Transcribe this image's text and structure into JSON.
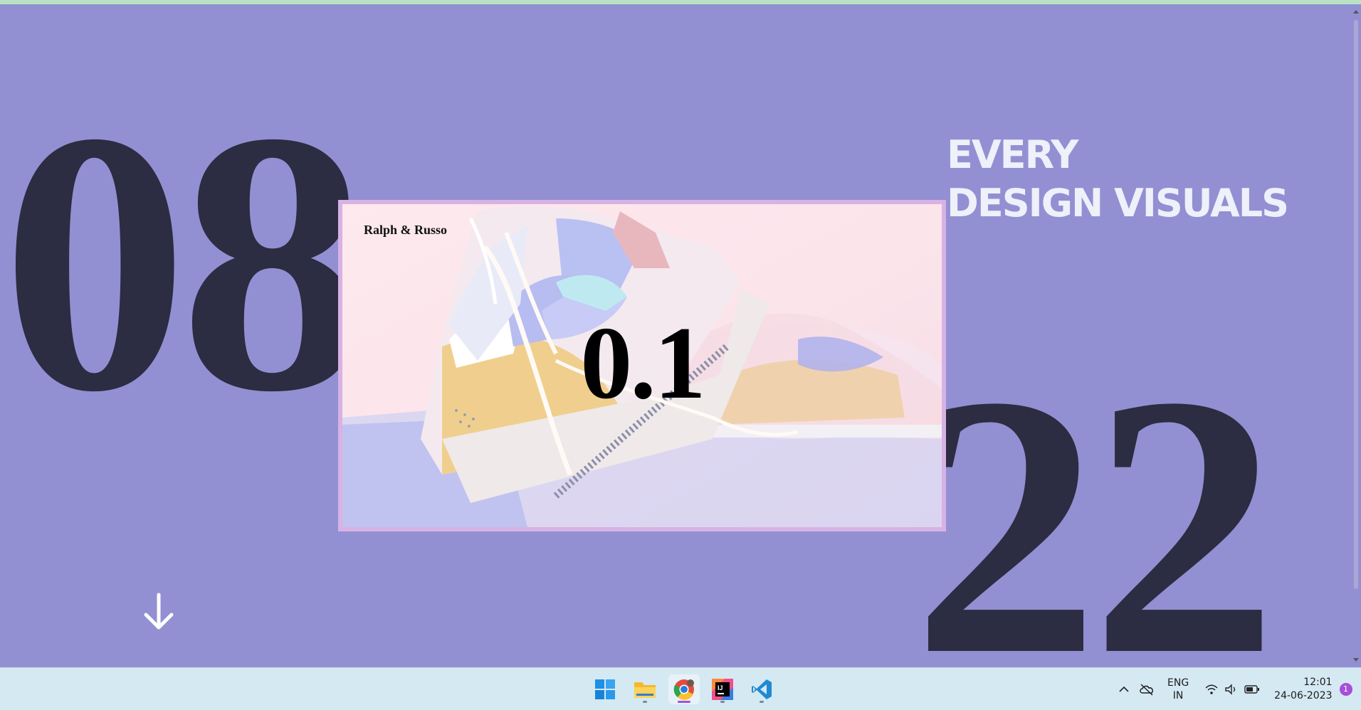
{
  "hero": {
    "number_left": "08",
    "number_right": "22",
    "headline_line1": "EVERY",
    "headline_line2": "DESIGN VISUALS"
  },
  "card": {
    "brand": "Ralph & Russo",
    "number": "0.1",
    "image_subject": "pastel sneakers photo"
  },
  "scroll_cue": {
    "icon": "arrow-down-icon"
  },
  "taskbar": {
    "apps": [
      {
        "name": "Start",
        "icon": "windows-start-icon"
      },
      {
        "name": "File Explorer",
        "icon": "folder-icon"
      },
      {
        "name": "Google Chrome",
        "icon": "chrome-icon"
      },
      {
        "name": "IntelliJ IDEA",
        "icon": "intellij-icon"
      },
      {
        "name": "Visual Studio Code",
        "icon": "vscode-icon"
      }
    ],
    "tray": {
      "language_line1": "ENG",
      "language_line2": "IN",
      "time": "12:01",
      "date": "24-06-2023",
      "notification_count": "1"
    }
  },
  "colors": {
    "background": "#9290d2",
    "numbers": "#2c2c42",
    "headline": "#eef0fa",
    "card_border": "#d8b2e4",
    "accent": "#a64fd8"
  }
}
